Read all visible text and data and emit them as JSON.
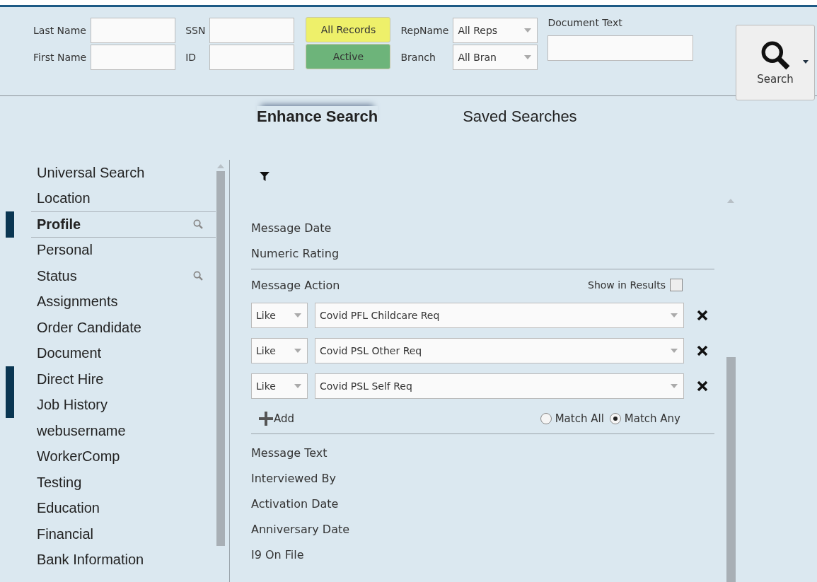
{
  "header": {
    "fields": [
      {
        "label": "Last Name"
      },
      {
        "label": "First Name"
      },
      {
        "label": "SSN"
      },
      {
        "label": "ID"
      }
    ],
    "status_buttons": [
      {
        "label": "All Records",
        "color": "#eef06a"
      },
      {
        "label": "Active",
        "color": "#6db47a"
      }
    ],
    "dropdowns": [
      {
        "label": "RepName",
        "value": "All Reps"
      },
      {
        "label": "Branch",
        "value": "All Bran"
      }
    ],
    "document_text": {
      "label": "Document Text"
    },
    "search_button": {
      "label": "Search"
    }
  },
  "tabs": [
    {
      "label": "Enhance Search",
      "selected": true
    },
    {
      "label": "Saved Searches",
      "selected": false
    }
  ],
  "sidebar": {
    "items": [
      {
        "label": "Universal Search",
        "selected": false,
        "marked": false,
        "search_icon": false
      },
      {
        "label": "Location",
        "selected": false,
        "marked": false,
        "search_icon": false
      },
      {
        "label": "Profile",
        "selected": true,
        "marked": true,
        "search_icon": true
      },
      {
        "label": "Personal",
        "selected": false,
        "marked": false,
        "search_icon": false
      },
      {
        "label": "Status",
        "selected": false,
        "marked": false,
        "search_icon": true
      },
      {
        "label": "Assignments",
        "selected": false,
        "marked": false,
        "search_icon": false
      },
      {
        "label": "Order Candidate",
        "selected": false,
        "marked": false,
        "search_icon": false
      },
      {
        "label": "Document",
        "selected": false,
        "marked": false,
        "search_icon": false
      },
      {
        "label": "Direct Hire",
        "selected": false,
        "marked": true,
        "search_icon": false
      },
      {
        "label": "Job History",
        "selected": false,
        "marked": true,
        "search_icon": false
      },
      {
        "label": "webusername",
        "selected": false,
        "marked": false,
        "search_icon": false
      },
      {
        "label": "WorkerComp",
        "selected": false,
        "marked": false,
        "search_icon": false
      },
      {
        "label": "Testing",
        "selected": false,
        "marked": false,
        "search_icon": false
      },
      {
        "label": "Education",
        "selected": false,
        "marked": false,
        "search_icon": false
      },
      {
        "label": "Financial",
        "selected": false,
        "marked": false,
        "search_icon": false
      },
      {
        "label": "Bank Information",
        "selected": false,
        "marked": false,
        "search_icon": false
      }
    ]
  },
  "fields": [
    {
      "label": "Message Date",
      "expanded": false
    },
    {
      "label": "Numeric Rating",
      "expanded": false
    },
    {
      "label": "Message Action",
      "expanded": true,
      "show_in_results_label": "Show in Results",
      "show_in_results": false,
      "criteria": [
        {
          "operator": "Like",
          "value": "Covid PFL Childcare Req"
        },
        {
          "operator": "Like",
          "value": "Covid PSL Other Req"
        },
        {
          "operator": "Like",
          "value": "Covid PSL Self Req"
        }
      ],
      "add_label": "Add",
      "match": [
        {
          "label": "Match All",
          "selected": false
        },
        {
          "label": "Match Any",
          "selected": true
        }
      ]
    },
    {
      "label": "Message Text",
      "expanded": false
    },
    {
      "label": "Interviewed By",
      "expanded": false
    },
    {
      "label": "Activation Date",
      "expanded": false
    },
    {
      "label": "Anniversary Date",
      "expanded": false
    },
    {
      "label": "I9 On File",
      "expanded": false
    }
  ]
}
